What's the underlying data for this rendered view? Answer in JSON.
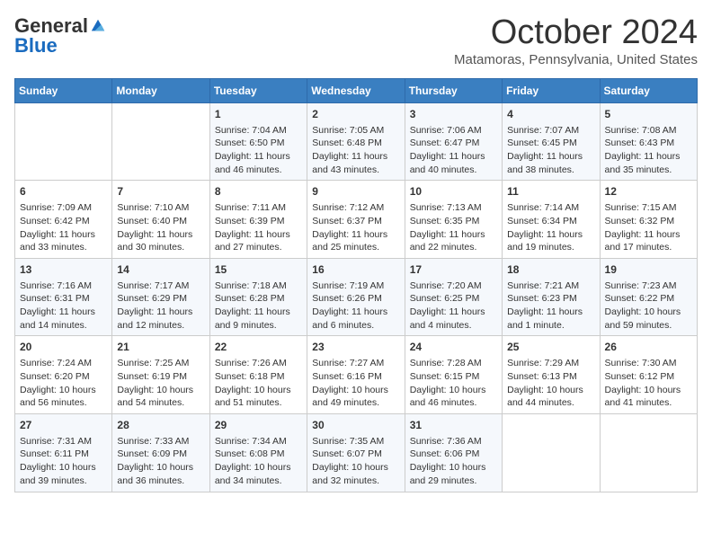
{
  "header": {
    "logo_general": "General",
    "logo_blue": "Blue",
    "month_title": "October 2024",
    "subtitle": "Matamoras, Pennsylvania, United States"
  },
  "days_of_week": [
    "Sunday",
    "Monday",
    "Tuesday",
    "Wednesday",
    "Thursday",
    "Friday",
    "Saturday"
  ],
  "weeks": [
    [
      {
        "day": "",
        "info": ""
      },
      {
        "day": "",
        "info": ""
      },
      {
        "day": "1",
        "info": "Sunrise: 7:04 AM\nSunset: 6:50 PM\nDaylight: 11 hours and 46 minutes."
      },
      {
        "day": "2",
        "info": "Sunrise: 7:05 AM\nSunset: 6:48 PM\nDaylight: 11 hours and 43 minutes."
      },
      {
        "day": "3",
        "info": "Sunrise: 7:06 AM\nSunset: 6:47 PM\nDaylight: 11 hours and 40 minutes."
      },
      {
        "day": "4",
        "info": "Sunrise: 7:07 AM\nSunset: 6:45 PM\nDaylight: 11 hours and 38 minutes."
      },
      {
        "day": "5",
        "info": "Sunrise: 7:08 AM\nSunset: 6:43 PM\nDaylight: 11 hours and 35 minutes."
      }
    ],
    [
      {
        "day": "6",
        "info": "Sunrise: 7:09 AM\nSunset: 6:42 PM\nDaylight: 11 hours and 33 minutes."
      },
      {
        "day": "7",
        "info": "Sunrise: 7:10 AM\nSunset: 6:40 PM\nDaylight: 11 hours and 30 minutes."
      },
      {
        "day": "8",
        "info": "Sunrise: 7:11 AM\nSunset: 6:39 PM\nDaylight: 11 hours and 27 minutes."
      },
      {
        "day": "9",
        "info": "Sunrise: 7:12 AM\nSunset: 6:37 PM\nDaylight: 11 hours and 25 minutes."
      },
      {
        "day": "10",
        "info": "Sunrise: 7:13 AM\nSunset: 6:35 PM\nDaylight: 11 hours and 22 minutes."
      },
      {
        "day": "11",
        "info": "Sunrise: 7:14 AM\nSunset: 6:34 PM\nDaylight: 11 hours and 19 minutes."
      },
      {
        "day": "12",
        "info": "Sunrise: 7:15 AM\nSunset: 6:32 PM\nDaylight: 11 hours and 17 minutes."
      }
    ],
    [
      {
        "day": "13",
        "info": "Sunrise: 7:16 AM\nSunset: 6:31 PM\nDaylight: 11 hours and 14 minutes."
      },
      {
        "day": "14",
        "info": "Sunrise: 7:17 AM\nSunset: 6:29 PM\nDaylight: 11 hours and 12 minutes."
      },
      {
        "day": "15",
        "info": "Sunrise: 7:18 AM\nSunset: 6:28 PM\nDaylight: 11 hours and 9 minutes."
      },
      {
        "day": "16",
        "info": "Sunrise: 7:19 AM\nSunset: 6:26 PM\nDaylight: 11 hours and 6 minutes."
      },
      {
        "day": "17",
        "info": "Sunrise: 7:20 AM\nSunset: 6:25 PM\nDaylight: 11 hours and 4 minutes."
      },
      {
        "day": "18",
        "info": "Sunrise: 7:21 AM\nSunset: 6:23 PM\nDaylight: 11 hours and 1 minute."
      },
      {
        "day": "19",
        "info": "Sunrise: 7:23 AM\nSunset: 6:22 PM\nDaylight: 10 hours and 59 minutes."
      }
    ],
    [
      {
        "day": "20",
        "info": "Sunrise: 7:24 AM\nSunset: 6:20 PM\nDaylight: 10 hours and 56 minutes."
      },
      {
        "day": "21",
        "info": "Sunrise: 7:25 AM\nSunset: 6:19 PM\nDaylight: 10 hours and 54 minutes."
      },
      {
        "day": "22",
        "info": "Sunrise: 7:26 AM\nSunset: 6:18 PM\nDaylight: 10 hours and 51 minutes."
      },
      {
        "day": "23",
        "info": "Sunrise: 7:27 AM\nSunset: 6:16 PM\nDaylight: 10 hours and 49 minutes."
      },
      {
        "day": "24",
        "info": "Sunrise: 7:28 AM\nSunset: 6:15 PM\nDaylight: 10 hours and 46 minutes."
      },
      {
        "day": "25",
        "info": "Sunrise: 7:29 AM\nSunset: 6:13 PM\nDaylight: 10 hours and 44 minutes."
      },
      {
        "day": "26",
        "info": "Sunrise: 7:30 AM\nSunset: 6:12 PM\nDaylight: 10 hours and 41 minutes."
      }
    ],
    [
      {
        "day": "27",
        "info": "Sunrise: 7:31 AM\nSunset: 6:11 PM\nDaylight: 10 hours and 39 minutes."
      },
      {
        "day": "28",
        "info": "Sunrise: 7:33 AM\nSunset: 6:09 PM\nDaylight: 10 hours and 36 minutes."
      },
      {
        "day": "29",
        "info": "Sunrise: 7:34 AM\nSunset: 6:08 PM\nDaylight: 10 hours and 34 minutes."
      },
      {
        "day": "30",
        "info": "Sunrise: 7:35 AM\nSunset: 6:07 PM\nDaylight: 10 hours and 32 minutes."
      },
      {
        "day": "31",
        "info": "Sunrise: 7:36 AM\nSunset: 6:06 PM\nDaylight: 10 hours and 29 minutes."
      },
      {
        "day": "",
        "info": ""
      },
      {
        "day": "",
        "info": ""
      }
    ]
  ]
}
